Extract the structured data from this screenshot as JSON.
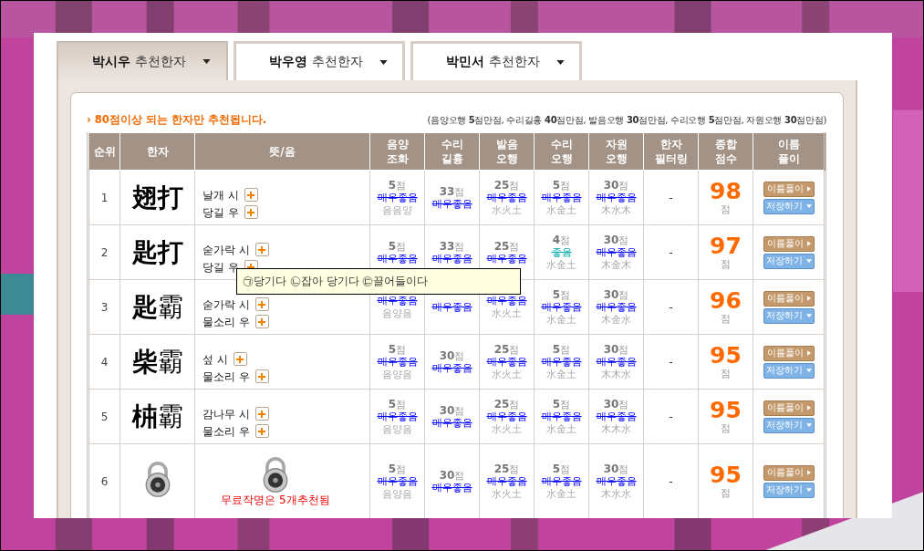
{
  "tabs": [
    {
      "label": "**박시우** 추천한자",
      "selected": true
    },
    {
      "label": "**박우영** 추천한자",
      "selected": false
    },
    {
      "label": "**박민서** 추천한자",
      "selected": false
    }
  ],
  "notice": "› 80점이상 되는 한자만 추천됩니다.",
  "max_scores": "(음양오행 **5**점만점, 수리길흉 **40**점만점, 발음오행 **30**점만점, 수리오행 **5**점만점, 자원오행 **30**점만점)",
  "columns": [
    "순위",
    "한자",
    "뜻/음",
    "음양\n조화",
    "수리\n길흉",
    "발음\n오행",
    "수리\n오행",
    "자원\n오행",
    "한자\n필터링",
    "종합\n점수",
    "이름\n풀이"
  ],
  "rows": [
    {
      "kind": "open",
      "rank": "1",
      "hanja": [
        {
          "char": "翅",
          "bold": true
        },
        {
          "char": "打",
          "bold": true
        }
      ],
      "meanings": [
        "날개 시",
        "당길 우"
      ],
      "cells": [
        {
          "score": "**5**점",
          "grade": "매우좋음",
          "color": "#0000ff",
          "detail": "음음양"
        },
        {
          "score": "**33**점",
          "grade": "매우좋음",
          "color": "#0000ff"
        },
        {
          "score": "**25**점",
          "grade": "매우좋음",
          "color": "#0000ff",
          "detail": "水火土"
        },
        {
          "score": "**5**점",
          "grade": "매우좋음",
          "color": "#0000ff",
          "detail": "水金土"
        },
        {
          "score": "**30**점",
          "grade": "매우좋음",
          "color": "#0000ff",
          "detail": "木水木"
        }
      ],
      "filter": "-",
      "total": "98",
      "unit": "점",
      "buttons": [
        "이름풀이",
        "저장하기"
      ]
    },
    {
      "kind": "open",
      "rank": "2",
      "hanja": [
        {
          "char": "匙",
          "bold": true
        },
        {
          "char": "打",
          "bold": true
        }
      ],
      "meanings": [
        "숟가락 시",
        "당길 우"
      ],
      "cells": [
        {
          "score": "**5**점",
          "grade": "매우좋음",
          "color": "#0000ff"
        },
        {
          "score": "**33**점",
          "grade": "매우좋음",
          "color": "#0000ff"
        },
        {
          "score": "**25**점",
          "grade": "매우좋음",
          "color": "#0000ff"
        },
        {
          "score": "**4**점",
          "grade": "좋음",
          "color": "#00aaaa",
          "detail": "水金土"
        },
        {
          "score": "**30**점",
          "grade": "매우좋음",
          "color": "#0000ff",
          "detail": "木金木"
        }
      ],
      "filter": "-",
      "total": "97",
      "unit": "점",
      "buttons": [
        "이름풀이",
        "저장하기"
      ]
    },
    {
      "kind": "open",
      "rank": "3",
      "hanja": [
        {
          "char": "匙",
          "bold": true
        },
        {
          "char": "霸",
          "bold": false
        }
      ],
      "meanings": [
        "숟가락 시",
        "물소리 우"
      ],
      "cells": [
        {
          "grade": "매우좋음",
          "color": "#0000ff",
          "detail": "음양음"
        },
        {
          "grade": "매우좋음",
          "color": "#0000ff"
        },
        {
          "grade": "매우좋음",
          "color": "#0000ff",
          "detail": "水火土"
        },
        {
          "score": "**5**점",
          "grade": "매우좋음",
          "color": "#0000ff",
          "detail": "水金土"
        },
        {
          "score": "**30**점",
          "grade": "매우좋음",
          "color": "#0000ff",
          "detail": "木金水"
        }
      ],
      "filter": "-",
      "total": "96",
      "unit": "점",
      "buttons": [
        "이름풀이",
        "저장하기"
      ]
    },
    {
      "kind": "open",
      "rank": "4",
      "hanja": [
        {
          "char": "柴",
          "bold": true
        },
        {
          "char": "霸",
          "bold": false
        }
      ],
      "meanings": [
        "섶 시",
        "물소리 우"
      ],
      "cells": [
        {
          "score": "**5**점",
          "grade": "매우좋음",
          "color": "#0000ff",
          "detail": "음양음"
        },
        {
          "score": "**30**점",
          "grade": "매우좋음",
          "color": "#0000ff"
        },
        {
          "score": "**25**점",
          "grade": "매우좋음",
          "color": "#0000ff",
          "detail": "水火土"
        },
        {
          "score": "**5**점",
          "grade": "매우좋음",
          "color": "#0000ff",
          "detail": "水金土"
        },
        {
          "score": "**30**점",
          "grade": "매우좋음",
          "color": "#0000ff",
          "detail": "木木水"
        }
      ],
      "filter": "-",
      "total": "95",
      "unit": "점",
      "buttons": [
        "이름풀이",
        "저장하기"
      ]
    },
    {
      "kind": "open",
      "rank": "5",
      "hanja": [
        {
          "char": "枾",
          "bold": true
        },
        {
          "char": "霸",
          "bold": false
        }
      ],
      "meanings": [
        "감나무 시",
        "물소리 우"
      ],
      "cells": [
        {
          "score": "**5**점",
          "grade": "매우좋음",
          "color": "#0000ff",
          "detail": "음양음"
        },
        {
          "score": "**30**점",
          "grade": "매우좋음",
          "color": "#0000ff"
        },
        {
          "score": "**25**점",
          "grade": "매우좋음",
          "color": "#0000ff",
          "detail": "水火土"
        },
        {
          "score": "**5**점",
          "grade": "매우좋음",
          "color": "#0000ff",
          "detail": "水金土"
        },
        {
          "score": "**30**점",
          "grade": "매우좋음",
          "color": "#0000ff",
          "detail": "木木水"
        }
      ],
      "filter": "-",
      "total": "95",
      "unit": "점",
      "buttons": [
        "이름풀이",
        "저장하기"
      ]
    },
    {
      "kind": "locked",
      "rank": "6",
      "lock_note": "무료작명은 5개추천됨",
      "cells": [
        {
          "score": "**5**점",
          "grade": "매우좋음",
          "color": "#0000ff",
          "detail": "음양음"
        },
        {
          "score": "**30**점",
          "grade": "매우좋음",
          "color": "#0000ff"
        },
        {
          "score": "**25**점",
          "grade": "매우좋음",
          "color": "#0000ff",
          "detail": "水火土"
        },
        {
          "score": "**5**점",
          "grade": "매우좋음",
          "color": "#0000ff",
          "detail": "水金土"
        },
        {
          "score": "**30**점",
          "grade": "매우좋음",
          "color": "#0000ff",
          "detail": "木水水"
        }
      ],
      "filter": "-",
      "total": "95",
      "unit": "점",
      "buttons": [
        "이름풀이",
        "저장하기"
      ]
    }
  ],
  "tooltip": "㉠당기다 ㉡잡아 당기다 ㉢끌어들이다"
}
